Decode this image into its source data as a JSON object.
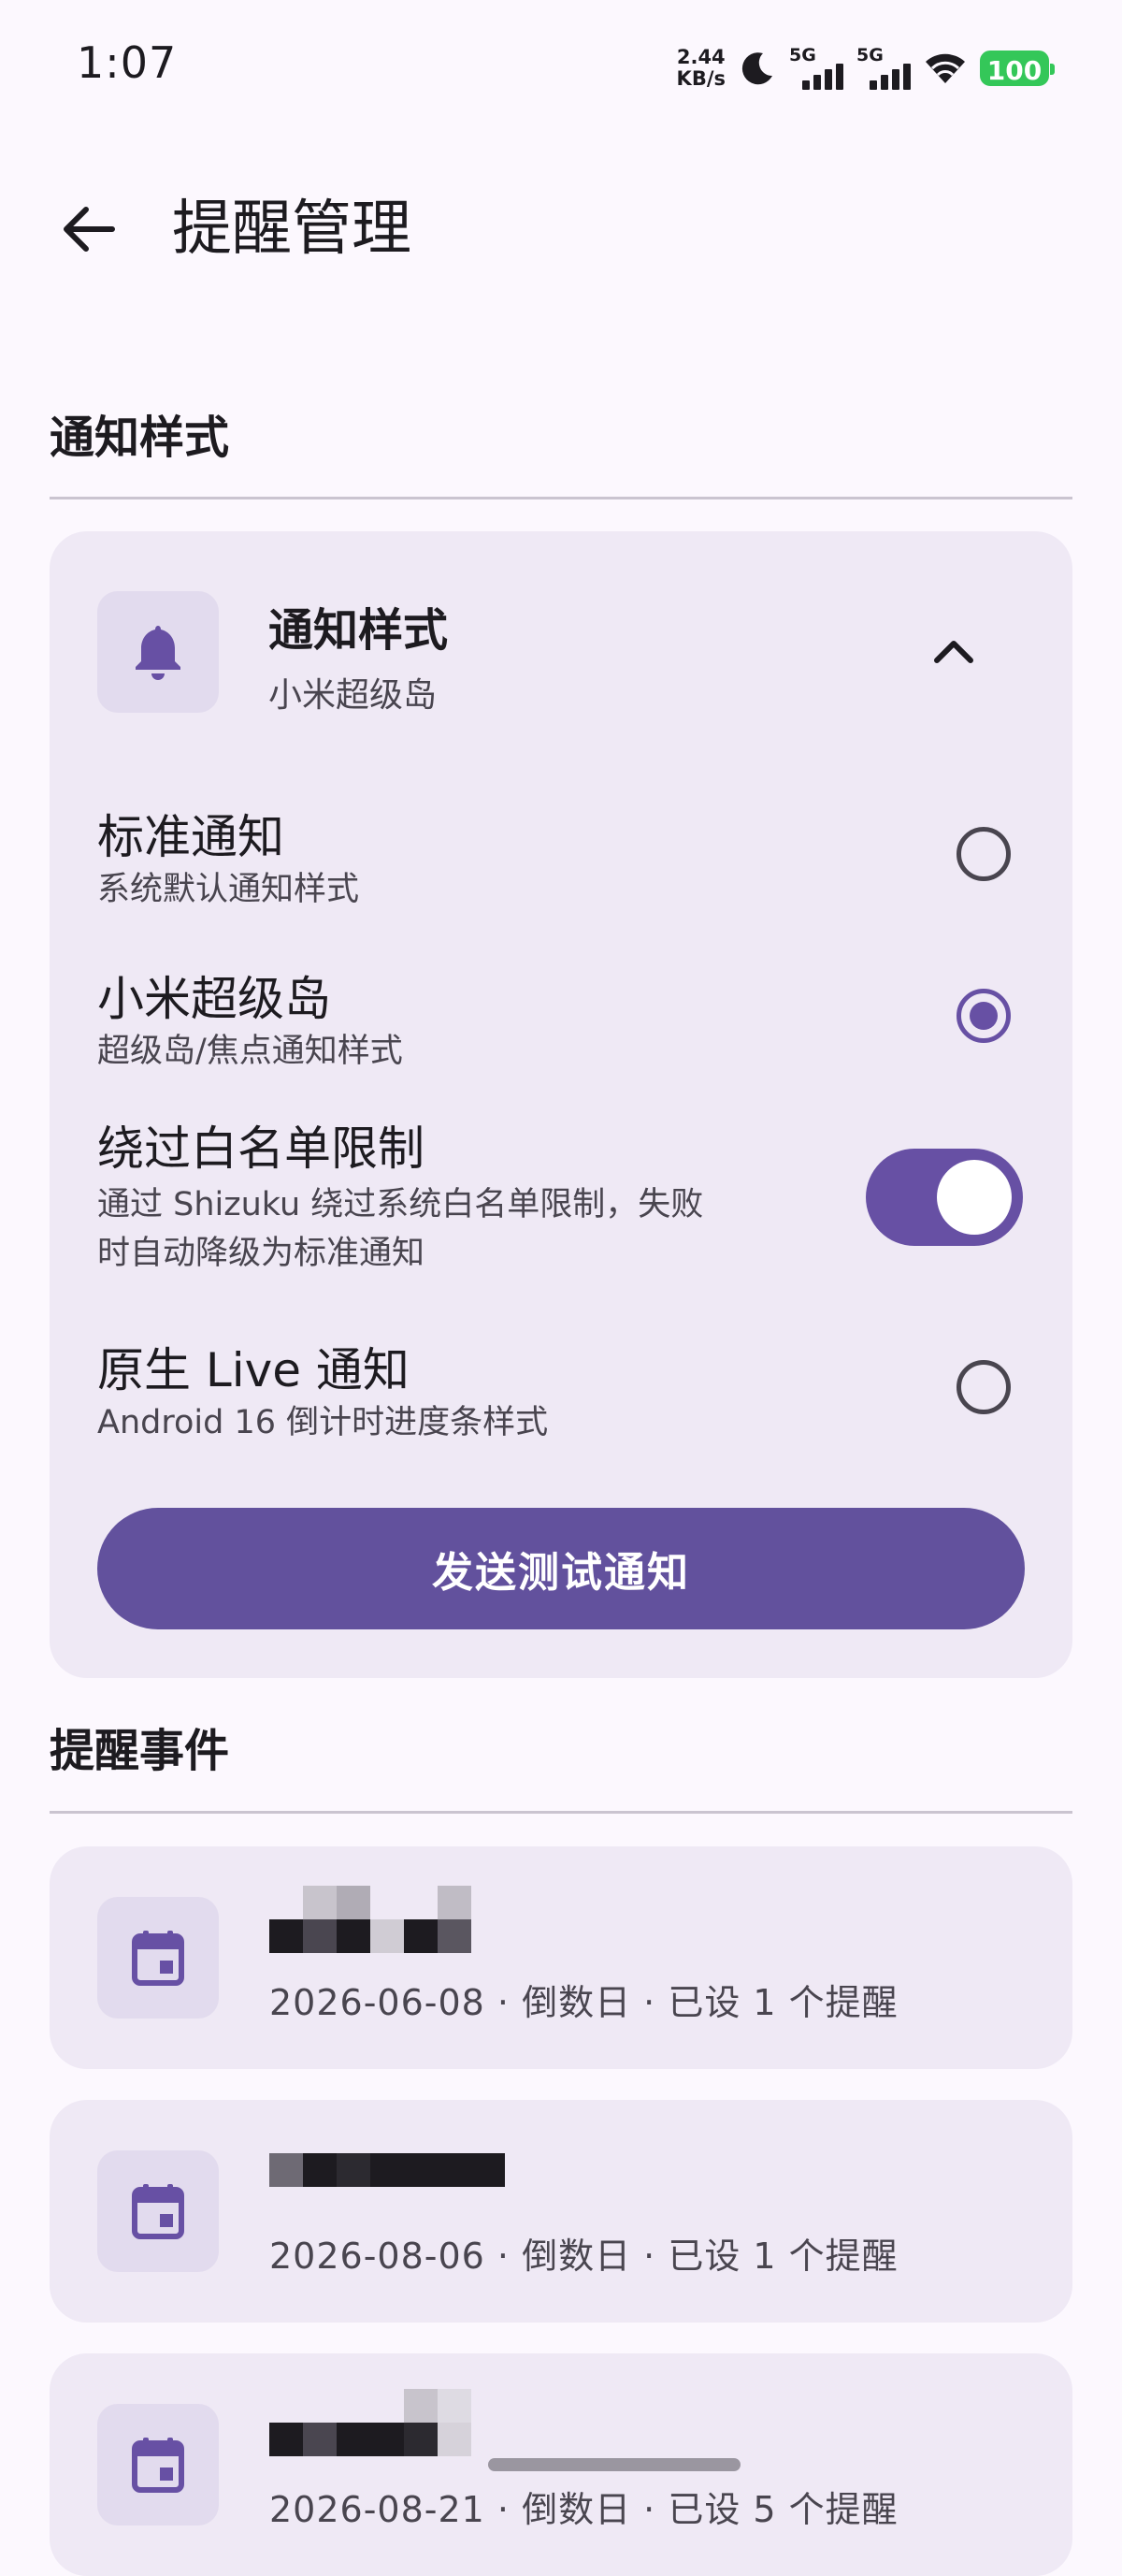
{
  "status_bar": {
    "time": "1:07",
    "net_speed_value": "2.44",
    "net_speed_unit": "KB/s",
    "sim1_label": "5G",
    "sim2_label": "5G",
    "battery": "100",
    "battery_color": "#34c759"
  },
  "app_bar": {
    "back_icon": "arrow-back-icon",
    "title": "提醒管理"
  },
  "notification_section": {
    "section_title": "通知样式",
    "card": {
      "icon": "bell-icon",
      "title": "通知样式",
      "subtitle": "小米超级岛",
      "expanded": true,
      "options": [
        {
          "title": "标准通知",
          "subtitle": "系统默认通知样式",
          "selected": false
        },
        {
          "title": "小米超级岛",
          "subtitle": "超级岛/焦点通知样式",
          "selected": true
        },
        {
          "title": "原生 Live 通知",
          "subtitle": "Android 16 倒计时进度条样式",
          "selected": false
        }
      ],
      "bypass": {
        "title": "绕过白名单限制",
        "subtitle_line1": "通过 Shizuku 绕过系统白名单限制，失败",
        "subtitle_line2": "时自动降级为标准通知",
        "enabled": true
      },
      "test_button": "发送测试通知"
    }
  },
  "events_section": {
    "section_title": "提醒事件",
    "events": [
      {
        "icon": "calendar-icon",
        "meta": "2026-06-08 · 倒数日 · 已设 1 个提醒"
      },
      {
        "icon": "calendar-icon",
        "meta": "2026-08-06 · 倒数日 · 已设 1 个提醒"
      },
      {
        "icon": "calendar-icon",
        "meta": "2026-08-21 · 倒数日 · 已设 5 个提醒"
      }
    ]
  },
  "accent_color": "#6750a4"
}
